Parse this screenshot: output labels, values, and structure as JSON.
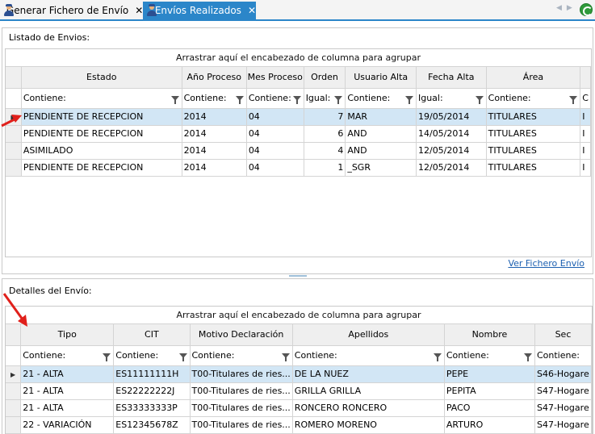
{
  "tabs": [
    {
      "label": "Generar Fichero de Envío",
      "active": false
    },
    {
      "label": "Envíos Realizados",
      "active": true
    }
  ],
  "close_glyph": "✕",
  "colors": {
    "accent": "#2b86c9",
    "selection": "#d2e6f5",
    "annotation": "#e0201b"
  },
  "top_panel": {
    "title": "Listado de Envios:",
    "group_hint": "Arrastrar aquí el encabezado de columna para agrupar",
    "columns": [
      "Estado",
      "Año Proceso",
      "Mes Proceso",
      "Orden",
      "Usuario Alta",
      "Fecha Alta",
      "Área"
    ],
    "filters": [
      "Contiene:",
      "Contiene:",
      "Contiene:",
      "Igual:",
      "Contiene:",
      "Igual:",
      "Contiene:",
      "C"
    ],
    "rows": [
      {
        "estado": "PENDIENTE DE RECEPCION",
        "anio": "2014",
        "mes": "04",
        "orden": "7",
        "usuario": "MAR",
        "fecha": "19/05/2014",
        "area": "TITULARES",
        "extra": "I"
      },
      {
        "estado": "PENDIENTE DE RECEPCION",
        "anio": "2014",
        "mes": "04",
        "orden": "6",
        "usuario": "AND",
        "fecha": "14/05/2014",
        "area": "TITULARES",
        "extra": "I"
      },
      {
        "estado": "ASIMILADO",
        "anio": "2014",
        "mes": "04",
        "orden": "4",
        "usuario": "AND",
        "fecha": "12/05/2014",
        "area": "TITULARES",
        "extra": "I"
      },
      {
        "estado": "PENDIENTE DE RECEPCION",
        "anio": "2014",
        "mes": "04",
        "orden": "1",
        "usuario": "_SGR",
        "fecha": "12/05/2014",
        "area": "TITULARES",
        "extra": "I"
      }
    ],
    "link": "Ver Fichero Envío"
  },
  "bottom_panel": {
    "title": "Detalles del Envío:",
    "group_hint": "Arrastrar aquí el encabezado de columna para agrupar",
    "columns": [
      "Tipo",
      "CIT",
      "Motivo Declaración",
      "Apellidos",
      "Nombre",
      "Sec"
    ],
    "filters": [
      "Contiene:",
      "Contiene:",
      "Contiene:",
      "Contiene:",
      "Contiene:",
      "Contiene:"
    ],
    "rows": [
      {
        "tipo": "21 - ALTA",
        "cit": "ES11111111H",
        "motivo": "T00-Titulares de ries...",
        "apellidos": "DE LA NUEZ",
        "nombre": "PEPE",
        "sec": "S46-Hogare"
      },
      {
        "tipo": "21 - ALTA",
        "cit": "ES22222222J",
        "motivo": "T00-Titulares de ries...",
        "apellidos": "GRILLA GRILLA",
        "nombre": "PEPITA",
        "sec": "S47-Hogare"
      },
      {
        "tipo": "21 - ALTA",
        "cit": "ES33333333P",
        "motivo": "T00-Titulares de ries...",
        "apellidos": "RONCERO RONCERO",
        "nombre": "PACO",
        "sec": "S47-Hogare"
      },
      {
        "tipo": "22 - VARIACIÓN",
        "cit": "ES12345678Z",
        "motivo": "T00-Titulares de ries...",
        "apellidos": "ROMERO MORENO",
        "nombre": "ARTURO",
        "sec": "S47-Hogare"
      }
    ]
  }
}
